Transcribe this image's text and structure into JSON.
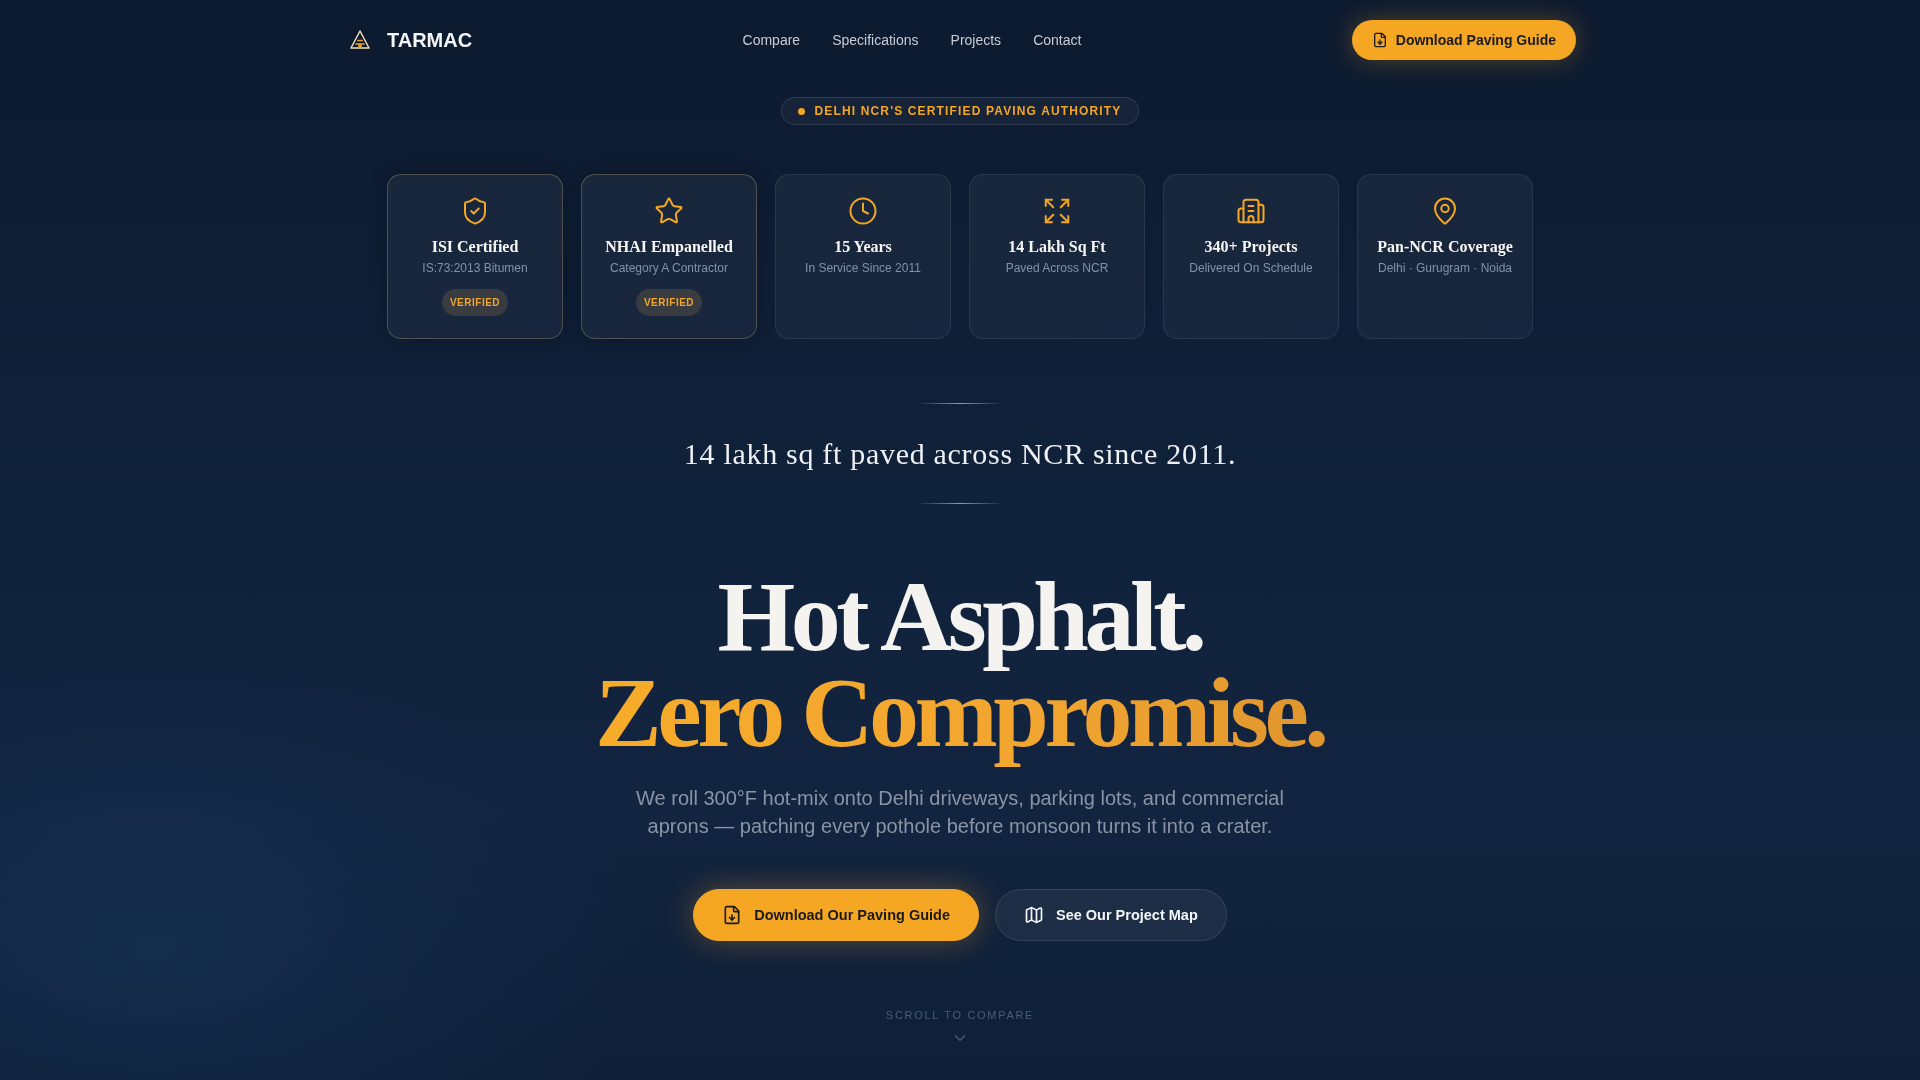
{
  "nav": {
    "brand": "TARMAC",
    "links": [
      "Compare",
      "Specifications",
      "Projects",
      "Contact"
    ],
    "cta": "Download Paving Guide"
  },
  "eyebrow": "DELHI NCR'S CERTIFIED PAVING AUTHORITY",
  "cards": [
    {
      "title": "ISI Certified",
      "subtitle": "IS:73:2013 Bitumen",
      "badge": "VERIFIED"
    },
    {
      "title": "NHAI Empanelled",
      "subtitle": "Category A Contractor",
      "badge": "VERIFIED"
    },
    {
      "title": "15 Years",
      "subtitle": "In Service Since 2011"
    },
    {
      "title": "14 Lakh Sq Ft",
      "subtitle": "Paved Across NCR"
    },
    {
      "title": "340+ Projects",
      "subtitle": "Delivered On Schedule"
    },
    {
      "title": "Pan-NCR Coverage",
      "subtitle": "Delhi · Gurugram · Noida"
    }
  ],
  "tagline": "14 lakh sq ft paved across NCR since 2011.",
  "hero": {
    "headline": "Hot Asphalt.",
    "headline_accent": "Zero Compromise.",
    "description": "We roll 300°F hot-mix onto Delhi driveways, parking lots, and commercial aprons — patching every pothole before monsoon turns it into a crater.",
    "buttons": [
      {
        "label": "Download Our Paving Guide",
        "kind": "primary"
      },
      {
        "label": "See Our Project Map",
        "kind": "secondary"
      }
    ]
  },
  "scroll_hint": "SCROLL TO COMPARE"
}
